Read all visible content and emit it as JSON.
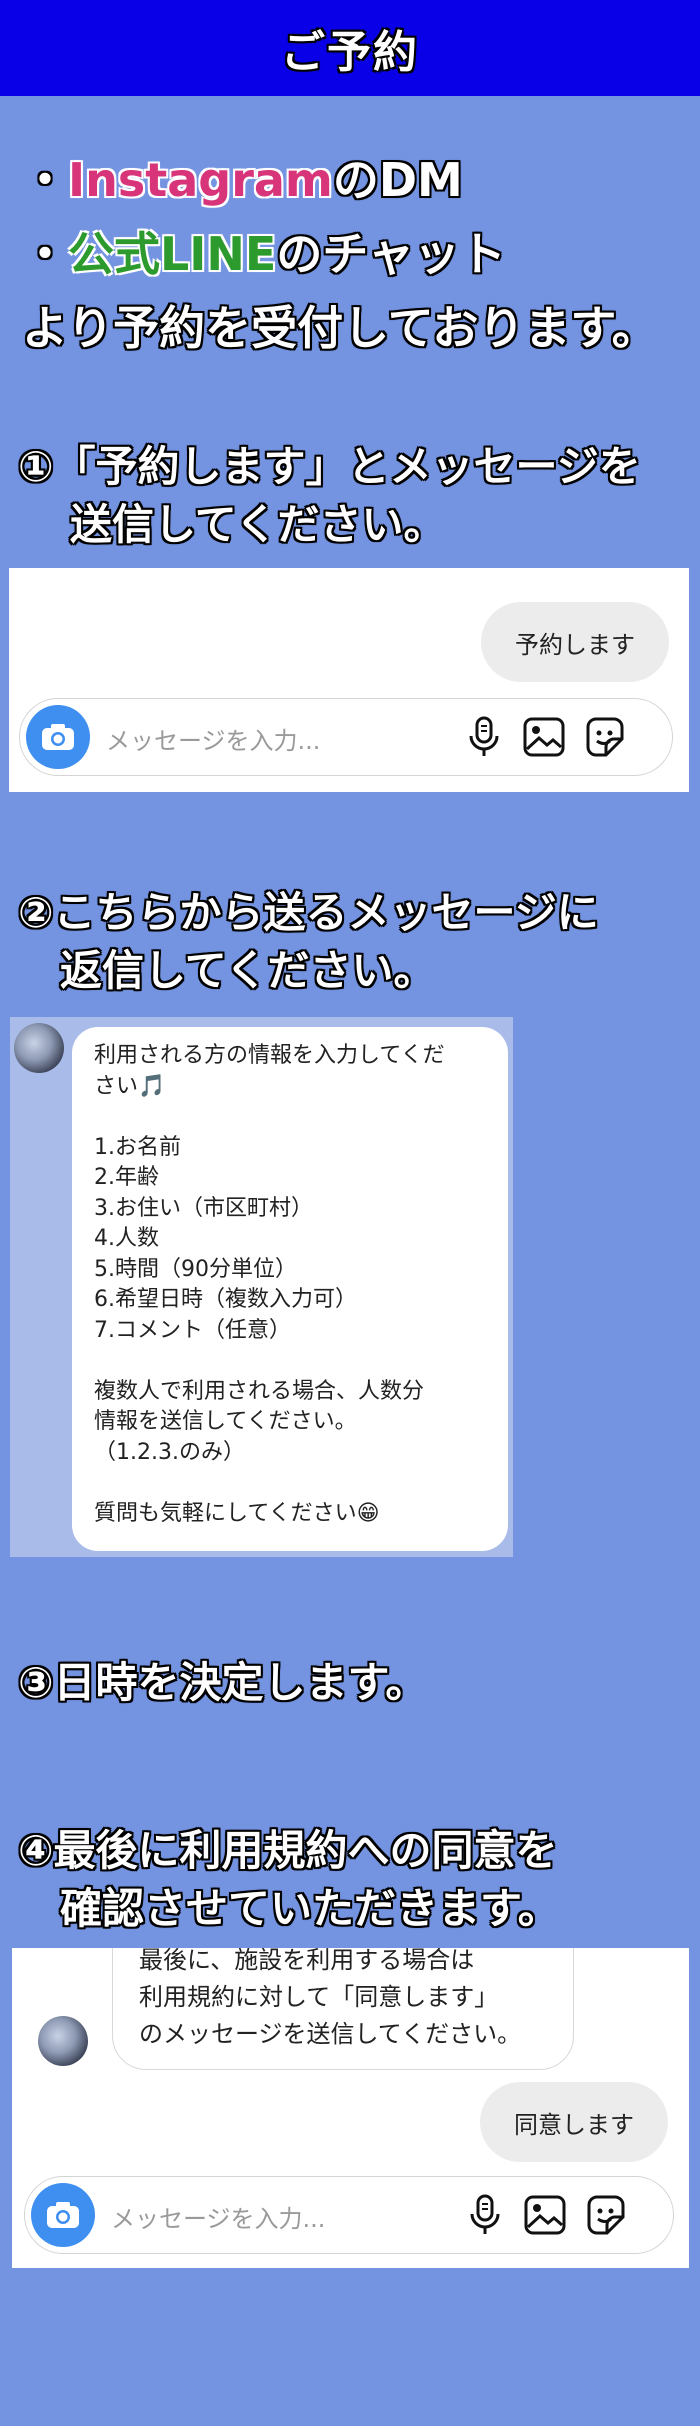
{
  "header": {
    "title": "ご予約"
  },
  "intro": {
    "line1_prefix": "・",
    "line1_brand": "Instagram",
    "line1_suffix": "のDM",
    "line2_prefix": "・",
    "line2_brand": "公式LINE",
    "line2_suffix": "のチャット",
    "line3": "より予約を受付しております。"
  },
  "steps": {
    "s1_line1": "①「予約します」とメッセージを",
    "s1_line2": "送信してください。",
    "s2_line1": "②こちらから送るメッセージに",
    "s2_line2": "返信してください。",
    "s3_line1": "③日時を決定します。",
    "s4_line1": "④最後に利用規約への同意を",
    "s4_line2": "確認させていただきます。"
  },
  "dm1": {
    "sent_message": "予約します",
    "input_placeholder": "メッセージを入力..."
  },
  "line_message": {
    "lines": [
      "利用される方の情報を入力してくだ",
      "さい🎵",
      "",
      "1.お名前",
      "2.年齢",
      "3.お住い（市区町村）",
      "4.人数",
      "5.時間（90分単位）",
      "6.希望日時（複数入力可）",
      "7.コメント（任意）",
      "",
      "複数人で利用される場合、人数分",
      "情報を送信してください。",
      "（1.2.3.のみ）",
      "",
      "質問も気軽にしてください😁"
    ]
  },
  "dm2": {
    "received_lines": [
      "最後に、施設を利用する場合は",
      "利用規約に対して「同意します」",
      "のメッセージを送信してください。"
    ],
    "sent_message": "同意します",
    "input_placeholder": "メッセージを入力..."
  },
  "colors": {
    "header_bg": "#0a00e8",
    "page_bg": "#7494e2",
    "instagram": "#d8347a",
    "line": "#2d9a2d",
    "camera_button": "#3f8ff0"
  },
  "icons": [
    "camera-icon",
    "microphone-icon",
    "image-icon",
    "sticker-icon"
  ]
}
